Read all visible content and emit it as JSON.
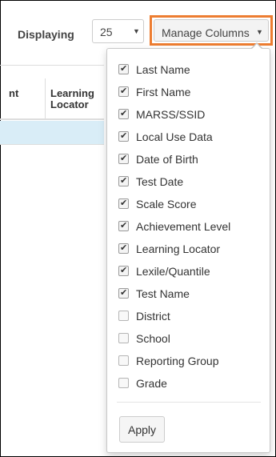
{
  "toolbar": {
    "displaying_label": "Displaying",
    "page_size_value": "25",
    "manage_columns_label": "Manage Columns",
    "accent_color": "#ED7D31"
  },
  "table": {
    "headers": [
      "nt",
      "Learning Locator"
    ],
    "selected_row_color": "#d9edf7"
  },
  "columns_menu": {
    "options": [
      {
        "label": "Last Name",
        "checked": true
      },
      {
        "label": "First Name",
        "checked": true
      },
      {
        "label": "MARSS/SSID",
        "checked": true
      },
      {
        "label": "Local Use Data",
        "checked": true
      },
      {
        "label": "Date of Birth",
        "checked": true
      },
      {
        "label": "Test Date",
        "checked": true
      },
      {
        "label": "Scale Score",
        "checked": true
      },
      {
        "label": "Achievement Level",
        "checked": true
      },
      {
        "label": "Learning Locator",
        "checked": true
      },
      {
        "label": "Lexile/Quantile",
        "checked": true
      },
      {
        "label": "Test Name",
        "checked": true
      },
      {
        "label": "District",
        "checked": false
      },
      {
        "label": "School",
        "checked": false
      },
      {
        "label": "Reporting Group",
        "checked": false
      },
      {
        "label": "Grade",
        "checked": false
      }
    ],
    "apply_label": "Apply"
  }
}
